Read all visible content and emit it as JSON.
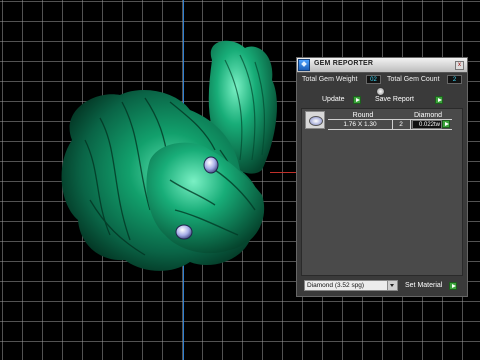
{
  "panel": {
    "title": "GEM REPORTER",
    "close_label": "x",
    "total_gem_weight_label": "Total Gem Weight",
    "total_gem_weight_value": "02",
    "total_gem_count_label": "Total Gem Count",
    "total_gem_count_value": "2",
    "update_label": "Update",
    "save_report_label": "Save Report",
    "table": {
      "headers": [
        "Round",
        "Diamond"
      ],
      "rows": [
        {
          "size": "1.76 X 1.30",
          "count": "2",
          "weight": "0.022tw"
        }
      ]
    },
    "material_select_value": "Diamond    (3.52 spg)",
    "set_material_label": "Set Material"
  },
  "viewport": {
    "model_color": "#0e7a55",
    "gem_color": "#7c86c8",
    "grid_color": "#969696",
    "axis_y_color": "#2f7fd0",
    "axis_x_color": "#c0302a"
  },
  "icons": [
    "app-icon",
    "close-icon",
    "gem-thumbnail-icon",
    "arrow-right-icon",
    "dropdown-arrow-icon"
  ]
}
